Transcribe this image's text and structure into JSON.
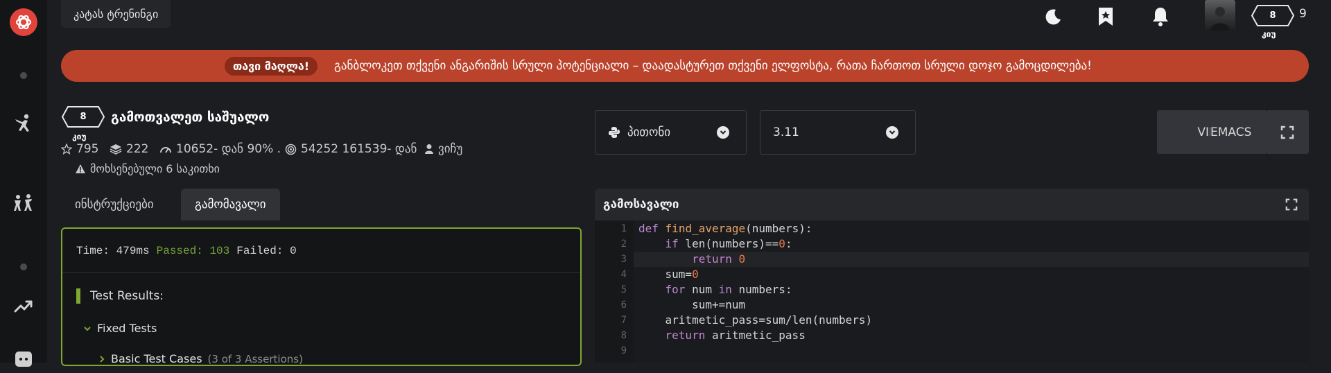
{
  "top_bar": {
    "kata_training": "კატას ტრენინგი",
    "user_rank": "8",
    "user_rank_label": "კიუ",
    "honor": "9"
  },
  "banner": {
    "pill": "თავი მაღლა!",
    "message": "განბლოკეთ თქვენი ანგარიშის სრული პოტენციალი – დაადასტურეთ თქვენი ელფოსტა, რათა ჩართოთ სრული დოჯო გამოცდილება!"
  },
  "kata": {
    "rank": "8",
    "rank_label": "კიუ",
    "title": "გამოთვალეთ საშუალო",
    "stars": "795",
    "collections": "222",
    "satisfaction": "10652- დან 90% .",
    "completions": "54252 161539- დან",
    "author": "ვიჩუ",
    "issues": "მოხსენებული 6 საკითხი"
  },
  "selects": {
    "language": "პითონი",
    "version": "3.11"
  },
  "modes": {
    "vim": "VIM",
    "emacs": "EMACS"
  },
  "tabs": {
    "instructions": "ინსტრუქციები",
    "output": "გამომავალი"
  },
  "results": {
    "time": "Time: 479ms",
    "passed": "Passed: 103",
    "failed": "Failed: 0",
    "test_results": "Test Results:",
    "fixed_tests": "Fixed Tests",
    "basic_cases": "Basic Test Cases",
    "basic_cases_sub": "(3 of 3 Assertions)"
  },
  "output_panel": {
    "title": "გამოსავალი"
  },
  "code": {
    "line_numbers": [
      "1",
      "2",
      "3",
      "4",
      "5",
      "6",
      "7",
      "8",
      "9"
    ],
    "lines": [
      "def find_average(numbers):",
      "    if len(numbers)==0:",
      "        return 0",
      "    sum=0",
      "    for num in numbers:",
      "        sum+=num",
      "    aritmetic_pass=sum/len(numbers)",
      "    return aritmetic_pass",
      ""
    ]
  },
  "colors": {
    "brand": "#e1443c",
    "banner": "#bb432c",
    "success": "#7ea733"
  },
  "icons": [
    "logo-icon",
    "swordsman-icon",
    "group-icon",
    "trending-icon",
    "discord-icon",
    "moon-icon",
    "bookmark-icon",
    "bell-icon",
    "star-icon",
    "layers-icon",
    "satisfaction-icon",
    "target-icon",
    "user-icon",
    "warning-icon",
    "python-icon",
    "chevron-down-icon",
    "fullscreen-icon"
  ]
}
